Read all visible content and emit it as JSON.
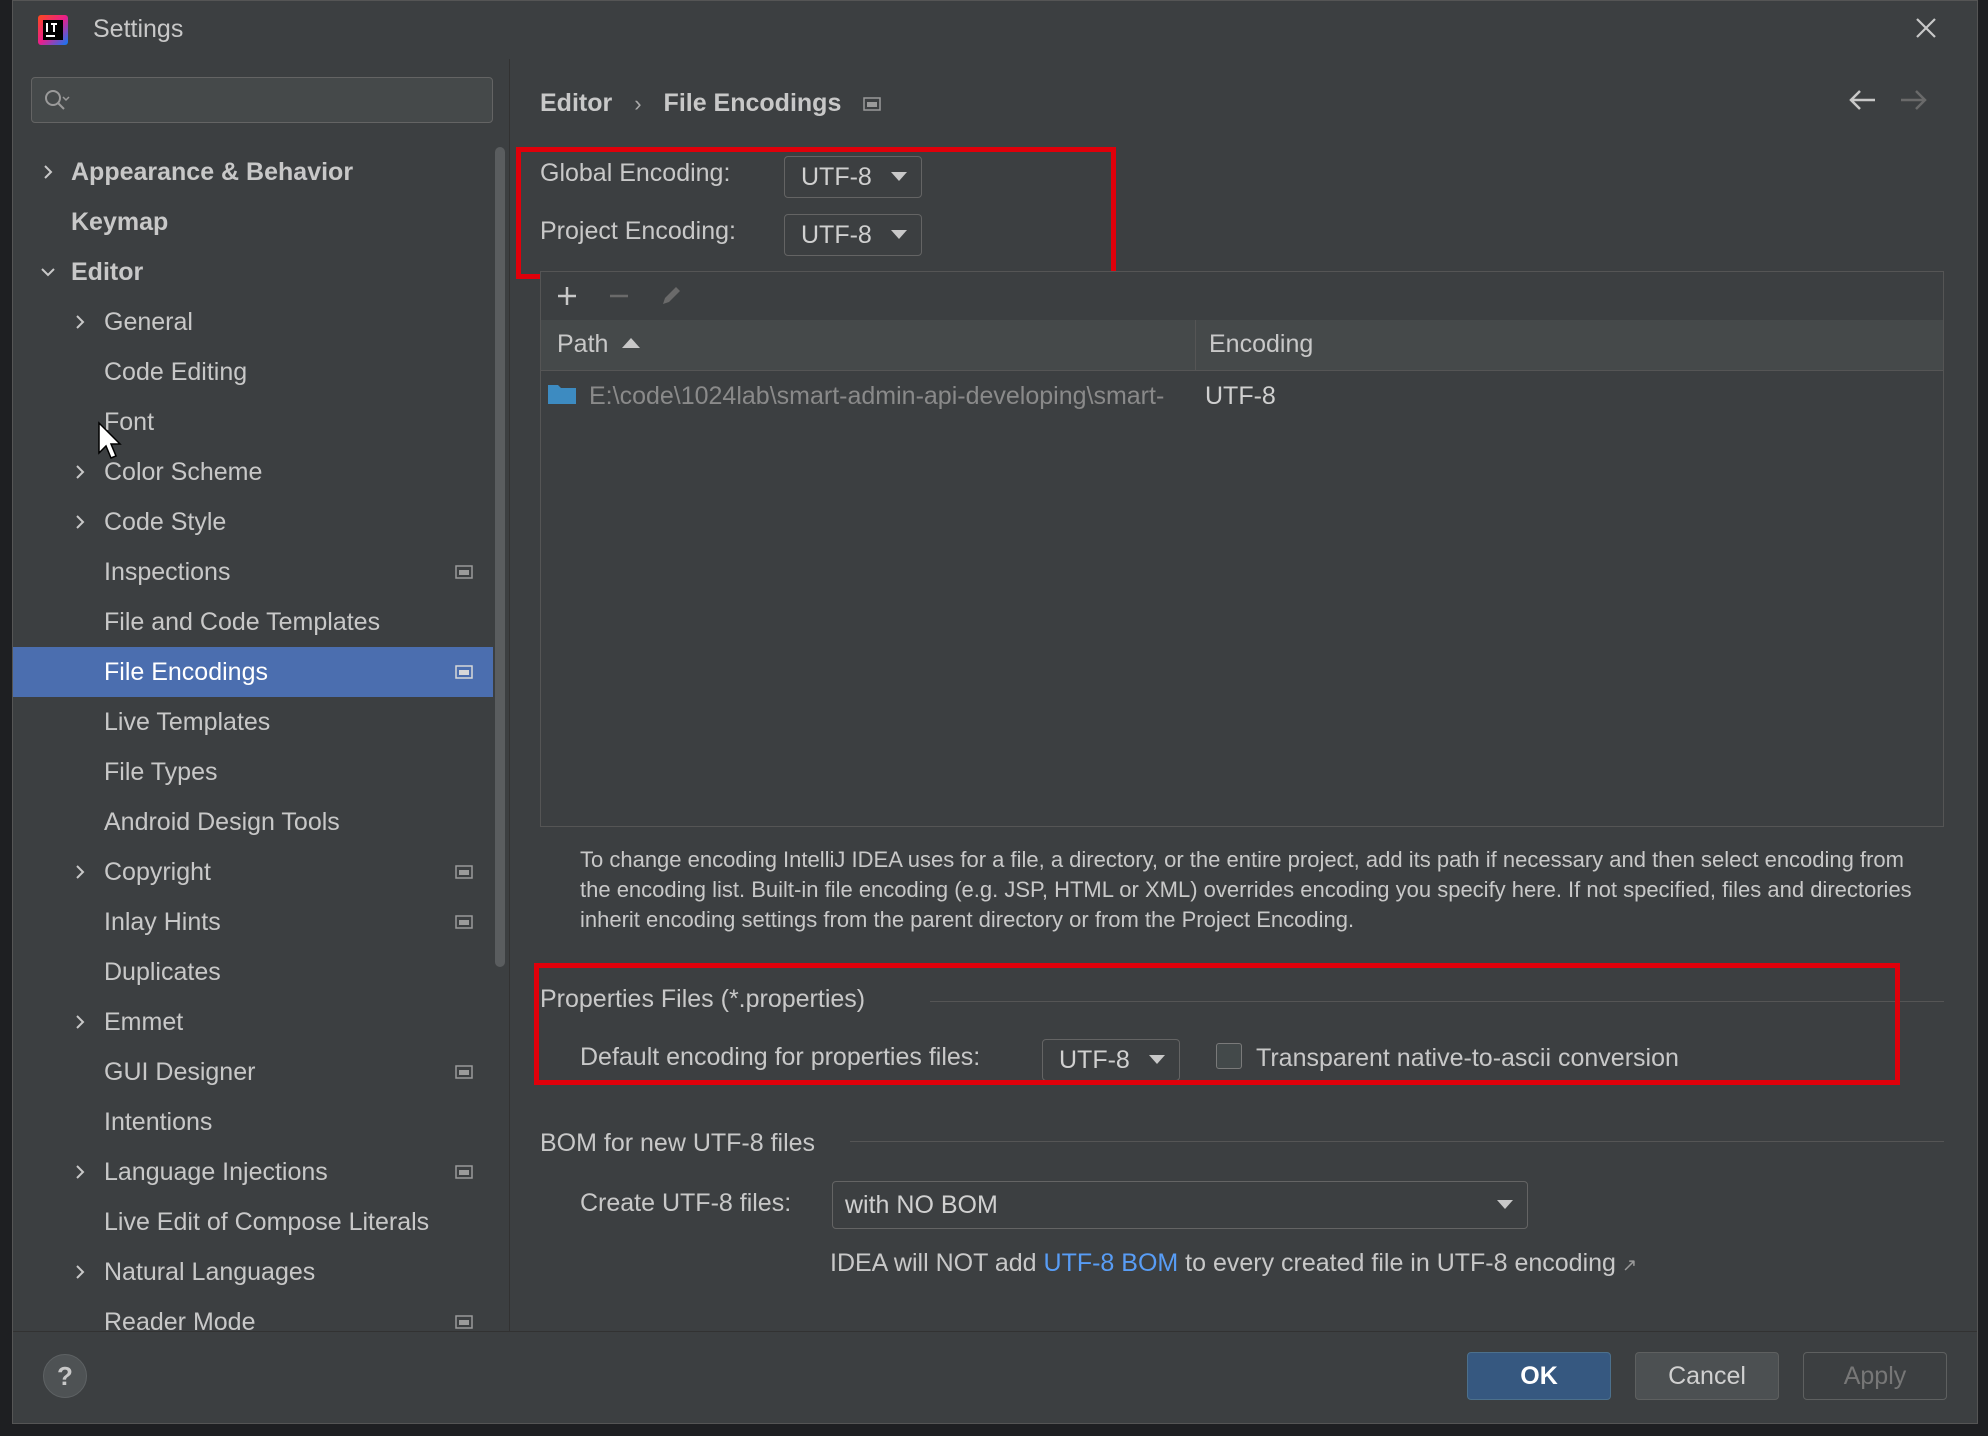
{
  "window": {
    "title": "Settings"
  },
  "search": {
    "placeholder": "",
    "value": ""
  },
  "sidebar": {
    "items": [
      {
        "label": "Appearance & Behavior"
      },
      {
        "label": "Keymap"
      },
      {
        "label": "Editor"
      },
      {
        "label": "General"
      },
      {
        "label": "Code Editing"
      },
      {
        "label": "Font"
      },
      {
        "label": "Color Scheme"
      },
      {
        "label": "Code Style"
      },
      {
        "label": "Inspections"
      },
      {
        "label": "File and Code Templates"
      },
      {
        "label": "File Encodings"
      },
      {
        "label": "Live Templates"
      },
      {
        "label": "File Types"
      },
      {
        "label": "Android Design Tools"
      },
      {
        "label": "Copyright"
      },
      {
        "label": "Inlay Hints"
      },
      {
        "label": "Duplicates"
      },
      {
        "label": "Emmet"
      },
      {
        "label": "GUI Designer"
      },
      {
        "label": "Intentions"
      },
      {
        "label": "Language Injections"
      },
      {
        "label": "Live Edit of Compose Literals"
      },
      {
        "label": "Natural Languages"
      },
      {
        "label": "Reader Mode"
      }
    ]
  },
  "breadcrumb": {
    "parent": "Editor",
    "separator": "›",
    "current": "File Encodings"
  },
  "encodings": {
    "global_label": "Global Encoding:",
    "global_value": "UTF-8",
    "project_label": "Project Encoding:",
    "project_value": "UTF-8"
  },
  "table": {
    "columns": [
      "Path",
      "Encoding"
    ],
    "rows": [
      {
        "path": "E:\\code\\1024lab\\smart-admin-api-developing\\smart-",
        "encoding": "UTF-8"
      }
    ]
  },
  "description": "To change encoding IntelliJ IDEA uses for a file, a directory, or the entire project, add its path if necessary and then select encoding from the encoding list. Built-in file encoding (e.g. JSP, HTML or XML) overrides encoding you specify here. If not specified, files and directories inherit encoding settings from the parent directory or from the Project Encoding.",
  "properties": {
    "section_title": "Properties Files (*.properties)",
    "default_label": "Default encoding for properties files:",
    "default_value": "UTF-8",
    "checkbox_label": "Transparent native-to-ascii conversion",
    "checkbox_checked": false
  },
  "bom": {
    "section_title": "BOM for new UTF-8 files",
    "create_label": "Create UTF-8 files:",
    "create_value": "with NO BOM",
    "hint_before": "IDEA will NOT add ",
    "hint_link": "UTF-8 BOM",
    "hint_after": " to every created file in UTF-8 encoding",
    "hint_arrow": "↗"
  },
  "footer": {
    "help": "?",
    "ok": "OK",
    "cancel": "Cancel",
    "apply": "Apply"
  },
  "colors": {
    "selection": "#4b6eaf",
    "highlight_box": "#e0000a",
    "link": "#589df6",
    "ok_button": "#365880"
  }
}
